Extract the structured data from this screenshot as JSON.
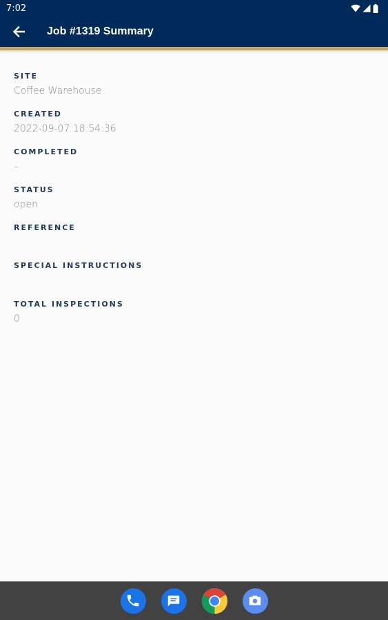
{
  "status_bar": {
    "time": "7:02",
    "icons": [
      "wifi-icon",
      "signal-icon",
      "battery-icon"
    ]
  },
  "app_bar": {
    "back_icon": "arrow-back-icon",
    "title": "Job #1319 Summary",
    "background": "#002a5a",
    "accent": "#c6ad7c"
  },
  "fields": {
    "site": {
      "label": "SITE",
      "value": "Coffee Warehouse"
    },
    "created": {
      "label": "CREATED",
      "value": "2022-09-07 18:54:36"
    },
    "completed": {
      "label": "COMPLETED",
      "value": "–"
    },
    "status": {
      "label": "STATUS",
      "value": "open"
    },
    "reference": {
      "label": "REFERENCE",
      "value": ""
    },
    "special_instructions": {
      "label": "SPECIAL INSTRUCTIONS",
      "value": ""
    },
    "total_inspections": {
      "label": "TOTAL INSPECTIONS",
      "value": "0"
    }
  },
  "dock": {
    "apps": [
      "phone-icon",
      "messages-icon",
      "chrome-icon",
      "camera-icon"
    ]
  }
}
